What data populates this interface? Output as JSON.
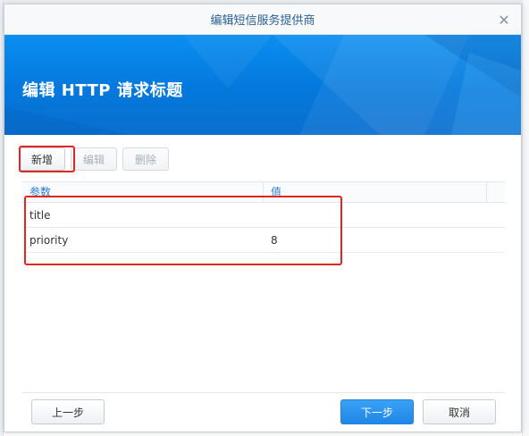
{
  "dialog": {
    "title": "编辑短信服务提供商",
    "close_glyph": "✕"
  },
  "banner": {
    "title": "编辑 HTTP 请求标题"
  },
  "toolbar": {
    "add_label": "新增",
    "edit_label": "编辑",
    "delete_label": "删除"
  },
  "grid": {
    "columns": [
      "参数",
      "值"
    ],
    "rows": [
      {
        "param": "title",
        "value": ""
      },
      {
        "param": "priority",
        "value": "8"
      }
    ]
  },
  "footer": {
    "prev_label": "上一步",
    "next_label": "下一步",
    "cancel_label": "取消"
  },
  "colors": {
    "accent": "#1e86e6",
    "banner": "#0478dc",
    "highlight": "#e02525"
  }
}
